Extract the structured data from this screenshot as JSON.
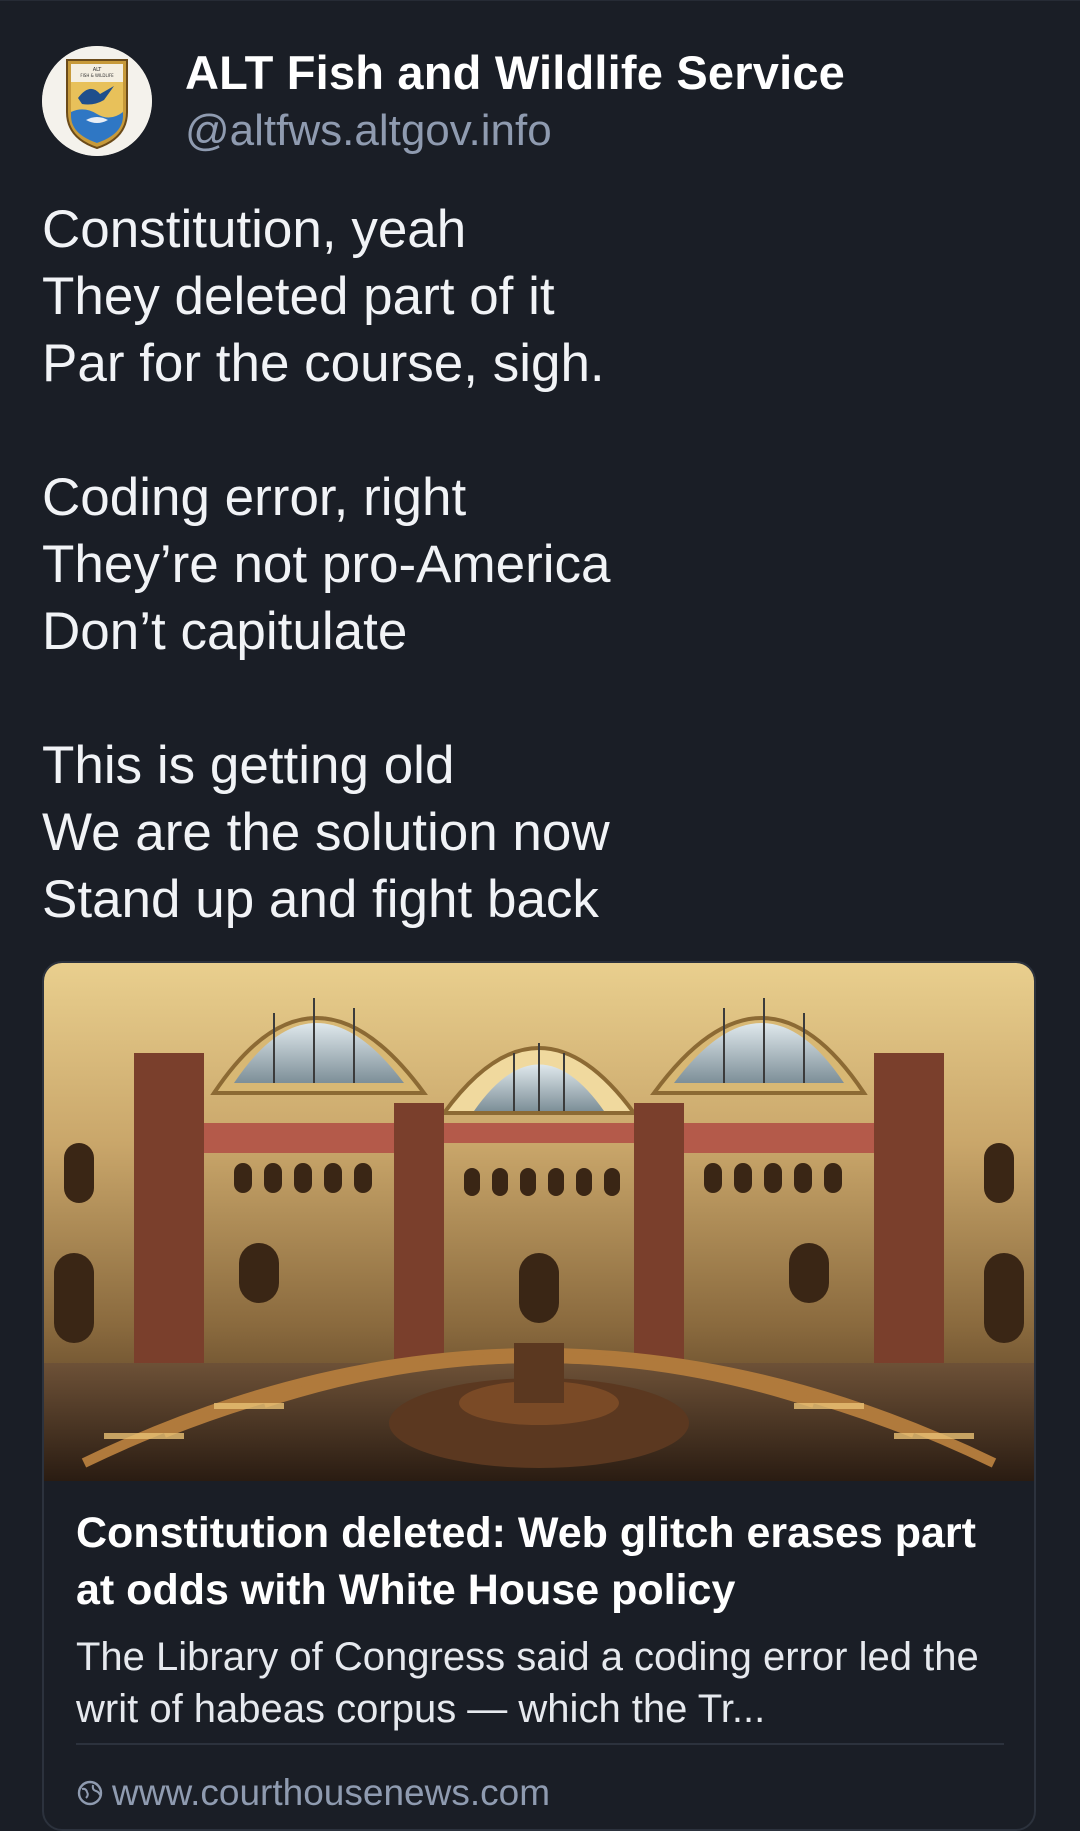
{
  "post": {
    "author": {
      "display_name": "ALT Fish and Wildlife Service",
      "handle": "@altfws.altgov.info",
      "avatar_text": "ALT FISH & WILDLIFE SERVICE"
    },
    "stanzas": [
      [
        "Constitution, yeah",
        "They deleted part of it",
        "Par for the course, sigh."
      ],
      [
        "Coding error, right",
        "They’re not pro-America",
        "Don’t capitulate"
      ],
      [
        "This is getting old",
        "We are the solution now",
        "Stand up and fight back"
      ]
    ],
    "link_card": {
      "image_icon": "library-reading-room-photo",
      "title": "Constitution deleted: Web glitch erases part at odds with White House policy",
      "description": "The Library of Congress said a coding error led the writ of habeas corpus — which the Tr...",
      "source": "www.courthousenews.com",
      "source_icon": "globe-icon"
    }
  },
  "colors": {
    "background": "#1a1e26",
    "text": "#ffffff",
    "muted": "#8f9bb0",
    "border": "#2c323d"
  }
}
